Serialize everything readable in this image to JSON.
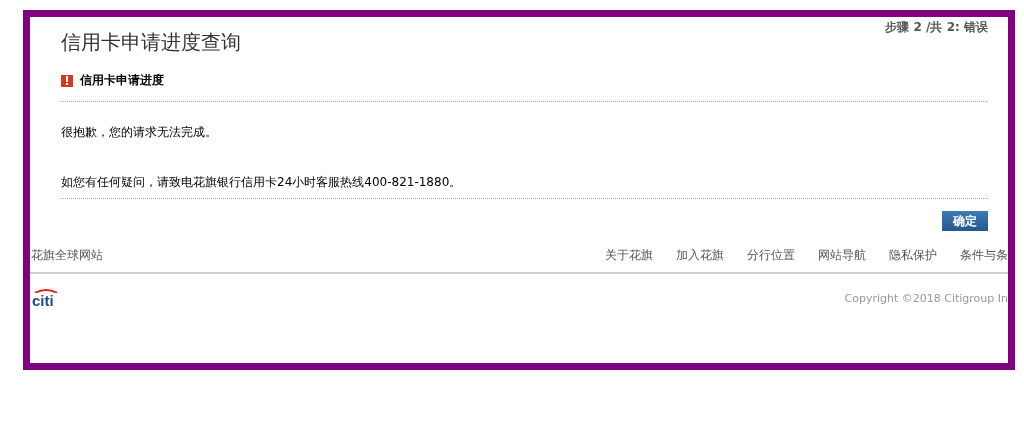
{
  "step_indicator": "步骤 2 /共 2: 错误",
  "page_title": "信用卡申请进度查询",
  "section": {
    "title": "信用卡申请进度"
  },
  "messages": [
    "很抱歉，您的请求无法完成。",
    "如您有任何疑问，请致电花旗银行信用卡24小时客服热线400-821-1880。"
  ],
  "confirm_button": "确定",
  "footer": {
    "global_link": "花旗全球网站",
    "links": [
      "关于花旗",
      "加入花旗",
      "分行位置",
      "网站导航",
      "隐私保护",
      "条件与条"
    ],
    "logo": "citi",
    "copyright": "Copyright ©2018 Citigroup In"
  }
}
